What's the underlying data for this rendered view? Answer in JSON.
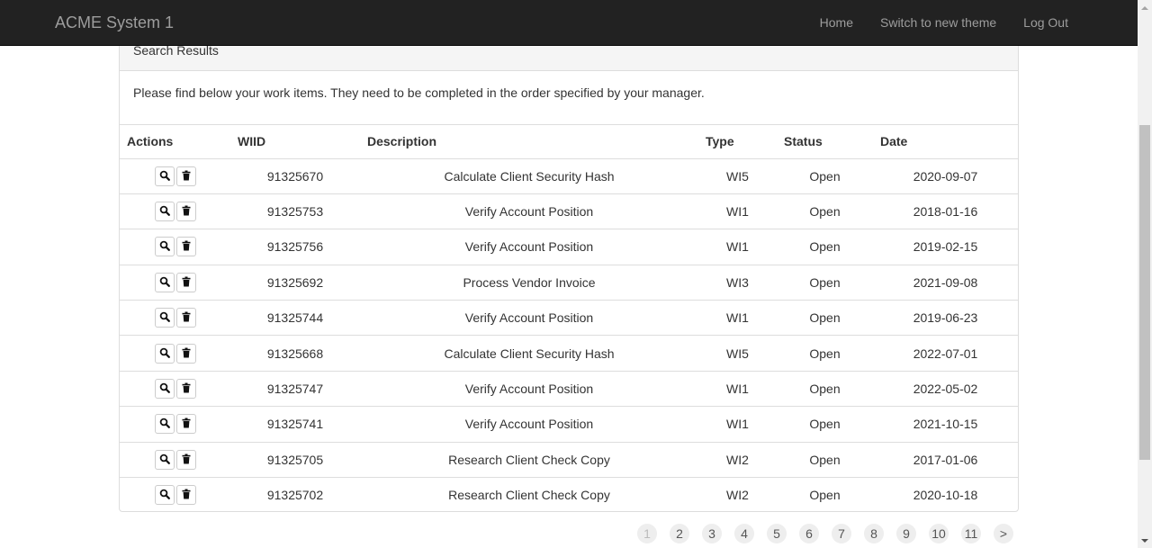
{
  "navbar": {
    "brand": "ACME System 1",
    "links": [
      "Home",
      "Switch to new theme",
      "Log Out"
    ]
  },
  "panel": {
    "heading": "Search Results",
    "message": "Please find below your work items. They need to be completed in the order specified by your manager."
  },
  "table": {
    "headers": [
      "Actions",
      "WIID",
      "Description",
      "Type",
      "Status",
      "Date"
    ],
    "rows": [
      [
        "91325670",
        "Calculate Client Security Hash",
        "WI5",
        "Open",
        "2020-09-07"
      ],
      [
        "91325753",
        "Verify Account Position",
        "WI1",
        "Open",
        "2018-01-16"
      ],
      [
        "91325756",
        "Verify Account Position",
        "WI1",
        "Open",
        "2019-02-15"
      ],
      [
        "91325692",
        "Process Vendor Invoice",
        "WI3",
        "Open",
        "2021-09-08"
      ],
      [
        "91325744",
        "Verify Account Position",
        "WI1",
        "Open",
        "2019-06-23"
      ],
      [
        "91325668",
        "Calculate Client Security Hash",
        "WI5",
        "Open",
        "2022-07-01"
      ],
      [
        "91325747",
        "Verify Account Position",
        "WI1",
        "Open",
        "2022-05-02"
      ],
      [
        "91325741",
        "Verify Account Position",
        "WI1",
        "Open",
        "2021-10-15"
      ],
      [
        "91325705",
        "Research Client Check Copy",
        "WI2",
        "Open",
        "2017-01-06"
      ],
      [
        "91325702",
        "Research Client Check Copy",
        "WI2",
        "Open",
        "2020-10-18"
      ]
    ],
    "row_action_icons": [
      "search-icon",
      "trash-icon"
    ]
  },
  "pagination": {
    "pages": [
      "1",
      "2",
      "3",
      "4",
      "5",
      "6",
      "7",
      "8",
      "9",
      "10",
      "11",
      ">"
    ],
    "current": "1"
  },
  "colors": {
    "navbar_bg": "#222222",
    "navbar_text": "#9d9d9d",
    "panel_heading_bg": "#f5f5f5",
    "border": "#dddddd"
  }
}
